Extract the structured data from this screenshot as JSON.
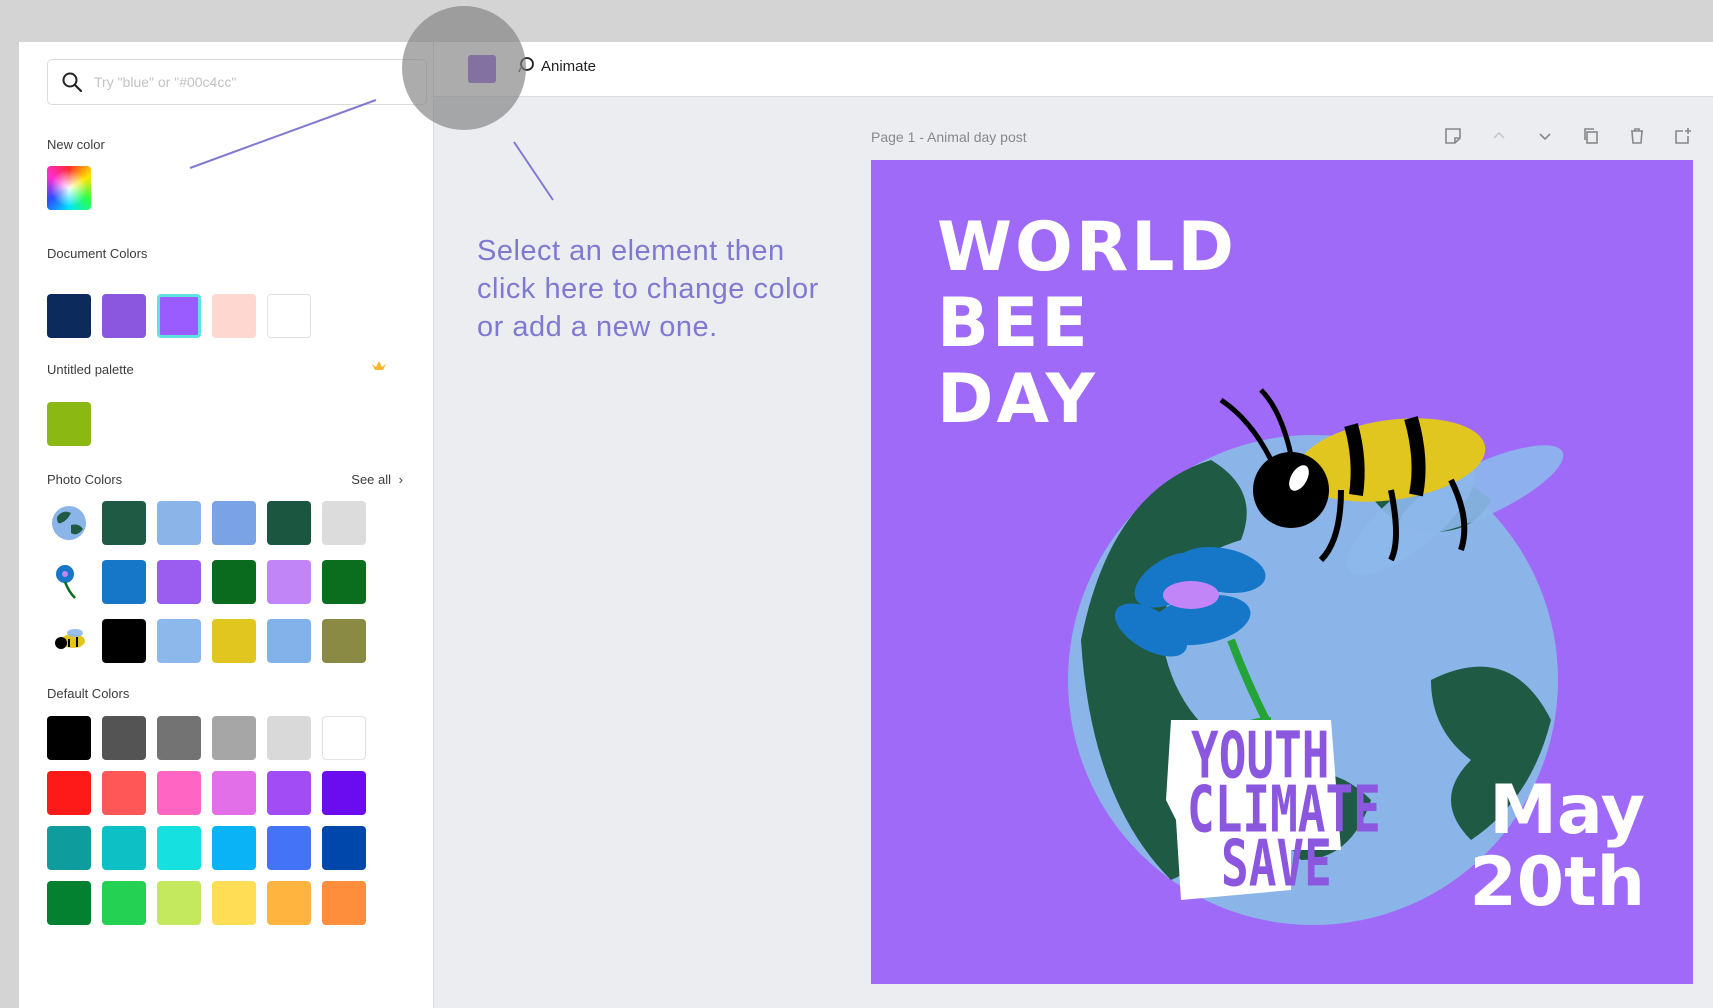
{
  "search": {
    "placeholder": "Try \"blue\" or \"#00c4cc\""
  },
  "sections": {
    "new_color": "New color",
    "document_colors": "Document Colors",
    "untitled_palette": "Untitled palette",
    "photo_colors": "Photo Colors",
    "see_all": "See all",
    "default_colors": "Default Colors"
  },
  "document_colors": [
    "#0c2a5c",
    "#8a57de",
    "#9b5cff",
    "#fdd7d0",
    "#ffffff"
  ],
  "palette_colors": [
    "#8cb813"
  ],
  "photo_colors": [
    [
      "#1f5a45",
      "#8bb4e8",
      "#7aa3e6",
      "#1b5640",
      "#dcdcdc"
    ],
    [
      "#1677c9",
      "#9b5cf0",
      "#0a6b1f",
      "#c285f7",
      "#0b6e1e"
    ],
    [
      "#000000",
      "#8db8ec",
      "#e2c620",
      "#83b2ea",
      "#8a8a45"
    ]
  ],
  "default_colors": [
    [
      "#000000",
      "#545454",
      "#737373",
      "#a6a6a6",
      "#d9d9d9",
      "#ffffff"
    ],
    [
      "#ff1a1a",
      "#ff5757",
      "#ff66c4",
      "#e36fe8",
      "#a14cf5",
      "#6a0bf0"
    ],
    [
      "#0f9c9c",
      "#0cc0c6",
      "#17e0e0",
      "#0ab3f5",
      "#4473f7",
      "#0047ab"
    ],
    [
      "#038030",
      "#24d152",
      "#c4e85e",
      "#ffdd55",
      "#ffb440",
      "#ff8e3c"
    ]
  ],
  "toolbar": {
    "current_color": "#8a57de",
    "animate_label": "Animate"
  },
  "page": {
    "label": "Page 1 - Animal day post"
  },
  "hint": "Select an element then click here to change color or add a new one.",
  "design": {
    "title_line1": "WORLD",
    "title_line2": "BEE",
    "title_line3": "DAY",
    "date_line1": "May",
    "date_line2": "20th",
    "badge_line1": "YOUTH",
    "badge_line2": "CLIMATE",
    "badge_line3": "SAVE",
    "background": "#a06af9"
  },
  "icons": {
    "search": "search-icon",
    "animate": "animate-icon",
    "notes": "notes-icon",
    "up": "chevron-up-icon",
    "down": "chevron-down-icon",
    "copy": "copy-icon",
    "delete": "trash-icon",
    "add": "add-page-icon",
    "crown": "crown-icon"
  }
}
